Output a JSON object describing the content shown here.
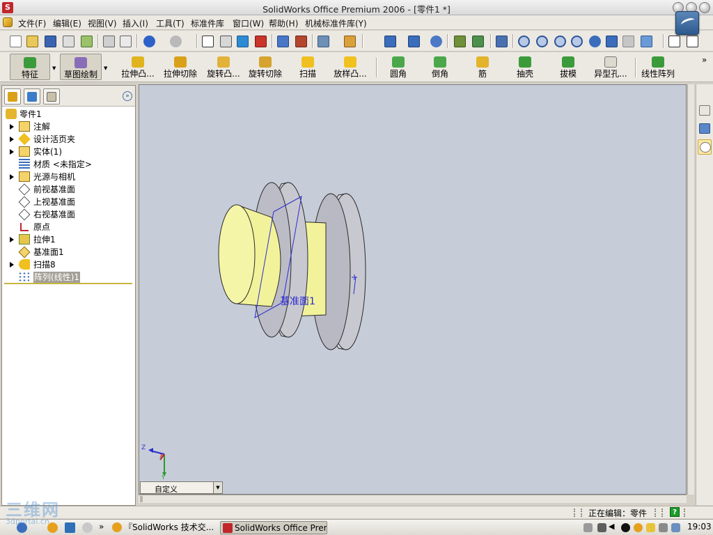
{
  "window": {
    "title": "SolidWorks Office Premium 2006 - [零件1 *]",
    "app_icon_text": "S"
  },
  "menu": {
    "items": [
      "文件(F)",
      "编辑(E)",
      "视图(V)",
      "插入(I)",
      "工具(T)",
      "标准件库",
      "窗口(W)",
      "帮助(H)",
      "机械标准件库(Y)"
    ],
    "mdi_close": "×"
  },
  "standard_toolbar": {
    "icons": [
      "new-icon",
      "open-icon",
      "save-icon",
      "print-icon",
      "print-preview-icon",
      "undo-icon",
      "redo-icon",
      "select-icon",
      "rebuild-icon",
      "options-icon",
      "zoom-to-fit-icon",
      "zoom-area-icon",
      "zoom-in-out-icon",
      "rotate-icon",
      "pan-icon",
      "view-orientation-icon",
      "display-style-icon"
    ]
  },
  "feature_toolbar": {
    "buttons": [
      {
        "label": "特征",
        "icon": "features-icon",
        "color": "#3b9b3b",
        "pressed": true
      },
      {
        "label": "草图绘制",
        "icon": "sketch-icon",
        "color": "#8a6db8",
        "pressed": true
      },
      {
        "label": "拉伸凸...",
        "icon": "extrude-boss-icon",
        "color": "#e0b41e"
      },
      {
        "label": "拉伸切除",
        "icon": "extrude-cut-icon",
        "color": "#d9a11a"
      },
      {
        "label": "旋转凸...",
        "icon": "revolve-boss-icon",
        "color": "#e1b33a"
      },
      {
        "label": "旋转切除",
        "icon": "revolve-cut-icon",
        "color": "#d6a32f"
      },
      {
        "label": "扫描",
        "icon": "sweep-icon",
        "color": "#f0c020"
      },
      {
        "label": "放样凸...",
        "icon": "loft-boss-icon",
        "color": "#f1c21f"
      },
      {
        "label": "圆角",
        "icon": "fillet-icon",
        "color": "#4aa84a"
      },
      {
        "label": "倒角",
        "icon": "chamfer-icon",
        "color": "#4aa84a"
      },
      {
        "label": "筋",
        "icon": "rib-icon",
        "color": "#e3b32a"
      },
      {
        "label": "抽壳",
        "icon": "shell-icon",
        "color": "#3b9b3b"
      },
      {
        "label": "拔模",
        "icon": "draft-icon",
        "color": "#3b9b3b"
      },
      {
        "label": "异型孔...",
        "icon": "hole-wizard-icon",
        "color": "#dcd9cf"
      },
      {
        "label": "线性阵列",
        "icon": "linear-pattern-icon",
        "color": "#3b9b3b"
      }
    ]
  },
  "tree": {
    "items": [
      {
        "label": "零件1",
        "icon": "part-icon",
        "expandable": false,
        "indent": 0
      },
      {
        "label": "注解",
        "icon": "annotations-icon",
        "expandable": true,
        "indent": 1
      },
      {
        "label": "设计活页夹",
        "icon": "design-binder-icon",
        "expandable": true,
        "indent": 1
      },
      {
        "label": "实体(1)",
        "icon": "solid-bodies-icon",
        "expandable": true,
        "indent": 1
      },
      {
        "label": "材质 <未指定>",
        "icon": "material-icon",
        "expandable": false,
        "indent": 1
      },
      {
        "label": "光源与相机",
        "icon": "lights-icon",
        "expandable": true,
        "indent": 1
      },
      {
        "label": "前视基准面",
        "icon": "plane-icon",
        "expandable": false,
        "indent": 1
      },
      {
        "label": "上视基准面",
        "icon": "plane-icon",
        "expandable": false,
        "indent": 1
      },
      {
        "label": "右视基准面",
        "icon": "plane-icon",
        "expandable": false,
        "indent": 1
      },
      {
        "label": "原点",
        "icon": "origin-icon",
        "expandable": false,
        "indent": 1
      },
      {
        "label": "拉伸1",
        "icon": "extrude-feature-icon",
        "expandable": true,
        "indent": 1
      },
      {
        "label": "基准面1",
        "icon": "ref-plane-icon",
        "expandable": false,
        "indent": 1
      },
      {
        "label": "扫描8",
        "icon": "sweep-feature-icon",
        "expandable": true,
        "indent": 1
      },
      {
        "label": "阵列(线性)1",
        "icon": "pattern-feature-icon",
        "expandable": false,
        "indent": 1,
        "selected": true
      }
    ]
  },
  "graphics": {
    "plane_label": "基准面1",
    "view_select": "自定义",
    "triad_x": "X",
    "triad_y": "Y",
    "triad_z": "Z"
  },
  "statusbar": {
    "text": "正在编辑：零件",
    "help": "?"
  },
  "taskbar": {
    "buttons": [
      {
        "label": "『SolidWorks 技术交...",
        "active": false
      },
      {
        "label": "SolidWorks Office Premi...",
        "active": true
      }
    ],
    "overflow": "»",
    "clock": "19:03"
  },
  "watermark": {
    "text": "三维网",
    "sub": "3dportal.cn"
  },
  "colors": {
    "viewport_bg": "#c6cdd9",
    "part_yellow": "#f2f29a",
    "flange_gray": "#c8c8d0",
    "edge": "#2a2a2a",
    "plane_blue": "#2b2bd0",
    "tree_selected": "#a3a096"
  }
}
